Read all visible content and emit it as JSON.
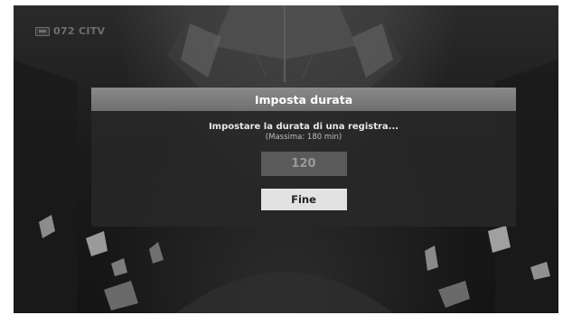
{
  "channel": {
    "icon": "tv-icon",
    "label": "072 CITV"
  },
  "dialog": {
    "title": "Imposta durata",
    "message": "Impostare la durata di una registra...",
    "hint": "(Massima: 180 min)",
    "duration_value": "120",
    "done_label": "Fine"
  },
  "colors": {
    "header": "#7d7d7d",
    "button": "#e2e2e2",
    "field": "#5a5a5a"
  }
}
